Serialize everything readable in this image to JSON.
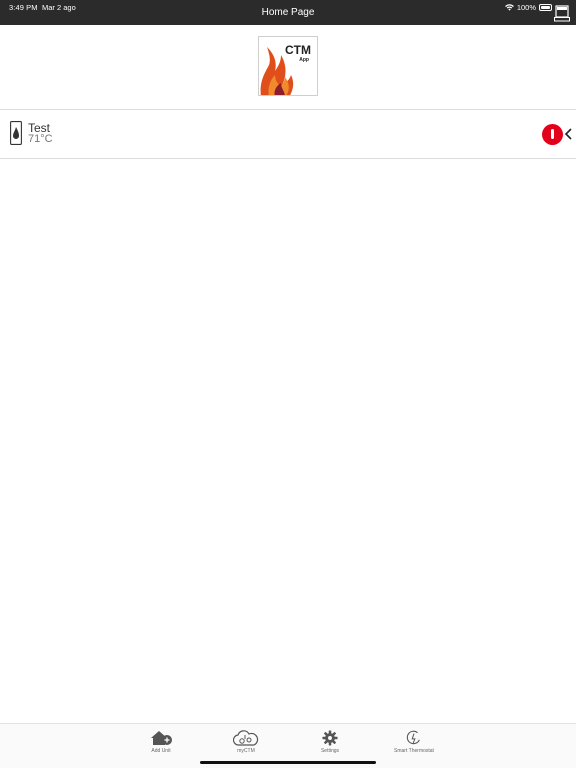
{
  "status_bar": {
    "time": "3:49 PM",
    "date": "Mar 2 ago",
    "battery": "100%"
  },
  "header": {
    "title": "Home Page"
  },
  "logo": {
    "brand": "CTM",
    "sub": "App"
  },
  "units": [
    {
      "name": "Test",
      "temperature": "71°C",
      "status_color": "#e2001a"
    }
  ],
  "tabbar": {
    "items": [
      {
        "label": "Add Unit",
        "icon": "house-plus-icon"
      },
      {
        "label": "myCTM",
        "icon": "cloud-icon"
      },
      {
        "label": "Settings",
        "icon": "gear-icon"
      },
      {
        "label": "Smart Thermostat",
        "icon": "thermostat-icon"
      }
    ]
  }
}
